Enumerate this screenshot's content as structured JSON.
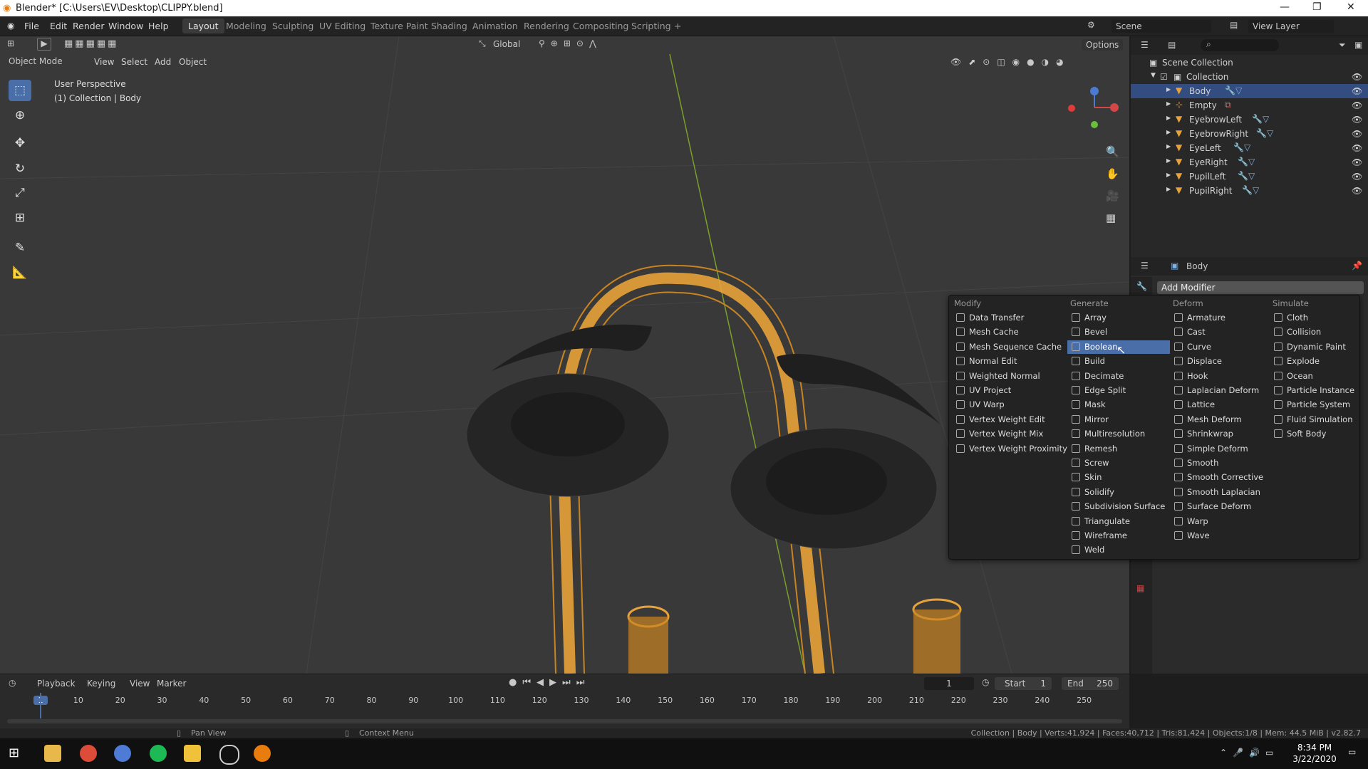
{
  "title": "Blender* [C:\\Users\\EV\\Desktop\\CLIPPY.blend]",
  "menu": [
    "File",
    "Edit",
    "Render",
    "Window",
    "Help"
  ],
  "workspaces": [
    "Layout",
    "Modeling",
    "Sculpting",
    "UV Editing",
    "Texture Paint",
    "Shading",
    "Animation",
    "Rendering",
    "Compositing",
    "Scripting"
  ],
  "active_workspace": "Layout",
  "scene": "Scene",
  "view_layer": "View Layer",
  "viewport": {
    "mode": "Object Mode",
    "menus": [
      "View",
      "Select",
      "Add",
      "Object"
    ],
    "orientation": "Global",
    "options": "Options",
    "perspective": "User Perspective",
    "collection_info": "(1) Collection | Body"
  },
  "outliner": {
    "root": "Scene Collection",
    "collection": "Collection",
    "items": [
      "Body",
      "Empty",
      "EyebrowLeft",
      "EyebrowRight",
      "EyeLeft",
      "EyeRight",
      "PupilLeft",
      "PupilRight"
    ],
    "selected": "Body"
  },
  "properties": {
    "object": "Body",
    "add_modifier": "Add Modifier"
  },
  "modifier_menu": {
    "headers": [
      "Modify",
      "Generate",
      "Deform",
      "Simulate"
    ],
    "modify": [
      "Data Transfer",
      "Mesh Cache",
      "Mesh Sequence Cache",
      "Normal Edit",
      "Weighted Normal",
      "UV Project",
      "UV Warp",
      "Vertex Weight Edit",
      "Vertex Weight Mix",
      "Vertex Weight Proximity"
    ],
    "generate": [
      "Array",
      "Bevel",
      "Boolean",
      "Build",
      "Decimate",
      "Edge Split",
      "Mask",
      "Mirror",
      "Multiresolution",
      "Remesh",
      "Screw",
      "Skin",
      "Solidify",
      "Subdivision Surface",
      "Triangulate",
      "Wireframe",
      "Weld"
    ],
    "deform": [
      "Armature",
      "Cast",
      "Curve",
      "Displace",
      "Hook",
      "Laplacian Deform",
      "Lattice",
      "Mesh Deform",
      "Shrinkwrap",
      "Simple Deform",
      "Smooth",
      "Smooth Corrective",
      "Smooth Laplacian",
      "Surface Deform",
      "Warp",
      "Wave"
    ],
    "simulate": [
      "Cloth",
      "Collision",
      "Dynamic Paint",
      "Explode",
      "Ocean",
      "Particle Instance",
      "Particle System",
      "Fluid Simulation",
      "Soft Body"
    ],
    "highlighted": "Boolean"
  },
  "timeline": {
    "menus": [
      "Playback",
      "Keying",
      "View",
      "Marker"
    ],
    "current_frame": "1",
    "start_label": "Start",
    "start": "1",
    "end_label": "End",
    "end": "250",
    "ticks": [
      "1",
      "10",
      "20",
      "30",
      "40",
      "50",
      "60",
      "70",
      "80",
      "90",
      "100",
      "110",
      "120",
      "130",
      "140",
      "150",
      "160",
      "170",
      "180",
      "190",
      "200",
      "210",
      "220",
      "230",
      "240",
      "250"
    ]
  },
  "status": {
    "pan": "Pan View",
    "context": "Context Menu",
    "stats": "Collection | Body | Verts:41,924 | Faces:40,712 | Tris:81,424 | Objects:1/8 | Mem: 44.5 MiB | v2.82.7"
  },
  "taskbar": {
    "time": "8:34 PM",
    "date": "3/22/2020"
  },
  "colors": {
    "accent": "#4a6ea8",
    "wire": "#e8a23a",
    "viewport_bg": "#393939"
  }
}
